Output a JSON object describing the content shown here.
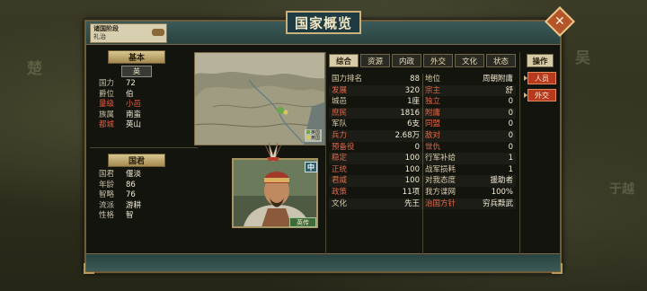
{
  "background": {
    "labels": [
      "楚",
      "吴",
      "于越"
    ]
  },
  "header": {
    "title": "国家概览",
    "stage_label": "诸国阶段",
    "stage_value": "礼治"
  },
  "basic": {
    "section_label": "基本",
    "country_name": "英",
    "fields": [
      {
        "key": "国力",
        "value": "72",
        "highlight": false
      },
      {
        "key": "爵位",
        "value": "伯",
        "highlight": false
      },
      {
        "key": "量级",
        "value": "小邑",
        "highlight": true
      },
      {
        "key": "族属",
        "value": "南蛮",
        "highlight": false
      },
      {
        "key": "都城",
        "value": "英山",
        "highlight": false
      }
    ]
  },
  "map": {
    "legend": [
      "英国",
      "黄国"
    ],
    "colors": [
      "#6aa84f",
      "#d9c65a"
    ]
  },
  "ruler": {
    "section_label": "国君",
    "fields": [
      {
        "key": "国君",
        "value": "偃淡"
      },
      {
        "key": "年龄",
        "value": "86"
      },
      {
        "key": "智略",
        "value": "76"
      },
      {
        "key": "流派",
        "value": "游耕"
      },
      {
        "key": "性格",
        "value": "智"
      }
    ],
    "badge_rank": "中",
    "bio_label": "英传"
  },
  "tabs": [
    "综合",
    "资源",
    "内政",
    "外交",
    "文化",
    "状态"
  ],
  "active_tab": "综合",
  "stats": [
    [
      {
        "key": "国力排名",
        "value": "88",
        "red": false
      },
      {
        "key": "地位",
        "value": "周朝附庸",
        "red": false
      }
    ],
    [
      {
        "key": "发展",
        "value": "320",
        "red": true
      },
      {
        "key": "宗主",
        "value": "舒",
        "red": true
      }
    ],
    [
      {
        "key": "城邑",
        "value": "1座",
        "red": false
      },
      {
        "key": "独立",
        "value": "0",
        "red": true
      }
    ],
    [
      {
        "key": "庶民",
        "value": "1816",
        "red": true
      },
      {
        "key": "附庸",
        "value": "0",
        "red": true
      }
    ],
    [
      {
        "key": "军队",
        "value": "6支",
        "red": false
      },
      {
        "key": "同盟",
        "value": "0",
        "red": true
      }
    ],
    [
      {
        "key": "兵力",
        "value": "2.68万",
        "red": true
      },
      {
        "key": "敌对",
        "value": "0",
        "red": true
      }
    ],
    [
      {
        "key": "预备役",
        "value": "0",
        "red": true
      },
      {
        "key": "世仇",
        "value": "0",
        "red": true
      }
    ],
    [
      {
        "key": "稳定",
        "value": "100",
        "red": true
      },
      {
        "key": "行军补给",
        "value": "1",
        "red": false
      }
    ],
    [
      {
        "key": "正统",
        "value": "100",
        "red": true
      },
      {
        "key": "战军损耗",
        "value": "1",
        "red": false
      }
    ],
    [
      {
        "key": "君威",
        "value": "100",
        "red": true
      },
      {
        "key": "对我态度",
        "value": "援助者",
        "red": false
      }
    ],
    [
      {
        "key": "政策",
        "value": "11项",
        "red": true
      },
      {
        "key": "我方谍网",
        "value": "100%",
        "red": false
      }
    ],
    [
      {
        "key": "文化",
        "value": "先王",
        "red": false
      },
      {
        "key": "治国方针",
        "value": "穷兵黩武",
        "red": true
      }
    ]
  ],
  "ops": {
    "header": "操作",
    "buttons": [
      "人员",
      "外交"
    ]
  }
}
